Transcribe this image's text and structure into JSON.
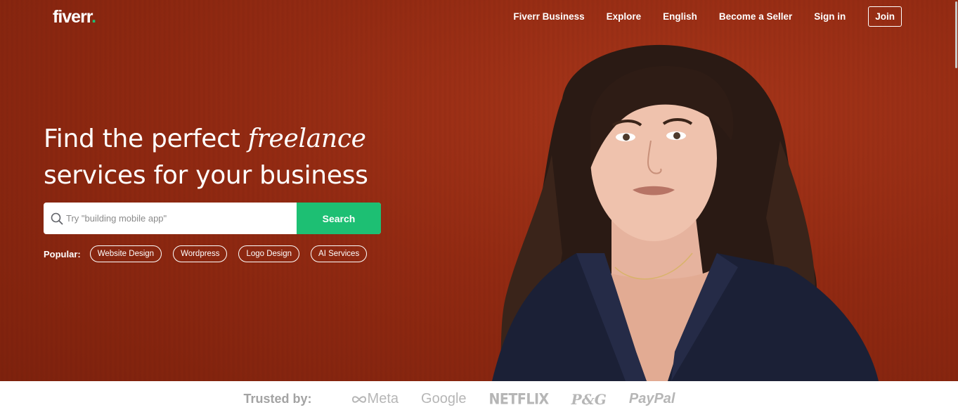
{
  "header": {
    "logo_text": "fiverr",
    "logo_dot": ".",
    "nav": {
      "fiverr_business": "Fiverr Business",
      "explore": "Explore",
      "language": "English",
      "become_seller": "Become a Seller",
      "sign_in": "Sign in",
      "join": "Join"
    }
  },
  "hero": {
    "headline_part1": "Find the perfect ",
    "headline_emphasis": "freelance",
    "headline_part2": "services for your business",
    "search": {
      "placeholder": "Try \"building mobile app\"",
      "value": "",
      "button_label": "Search"
    },
    "popular": {
      "label": "Popular:",
      "chips": [
        "Website Design",
        "Wordpress",
        "Logo Design",
        "AI Services"
      ]
    }
  },
  "trusted": {
    "label": "Trusted by:",
    "brands": [
      "Meta",
      "Google",
      "NETFLIX",
      "P&G",
      "PayPal"
    ]
  },
  "colors": {
    "hero_bg": "#932a12",
    "accent": "#1dbf73",
    "text_on_hero": "#ffffff",
    "brand_gray": "#b6b6b6"
  },
  "icons": {
    "search": "search-icon",
    "meta_logo": "meta-infinity-icon"
  }
}
